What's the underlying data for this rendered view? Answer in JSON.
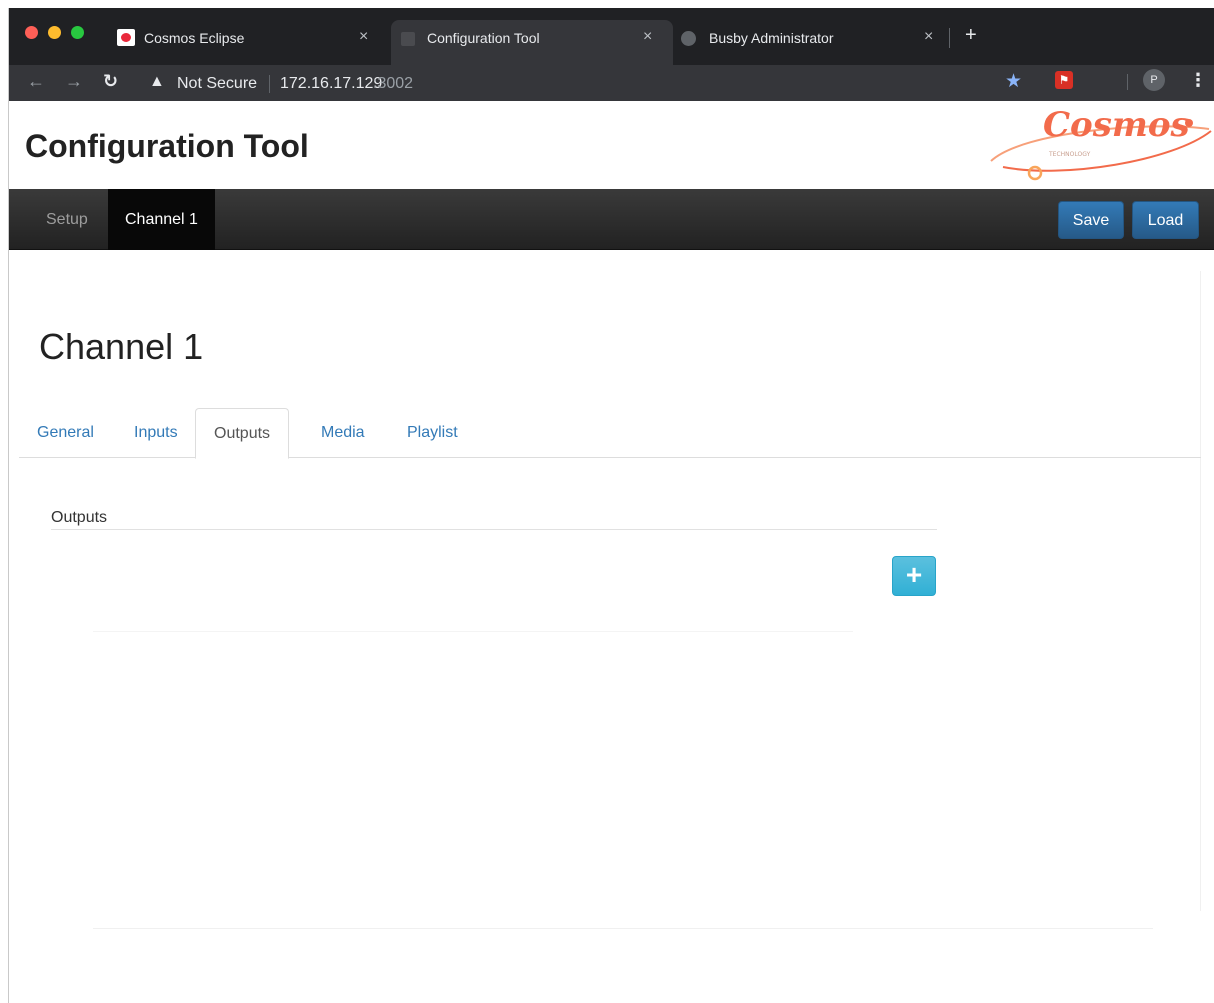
{
  "browser": {
    "tabs": [
      {
        "title": "Cosmos Eclipse",
        "active": false
      },
      {
        "title": "Configuration Tool",
        "active": true
      },
      {
        "title": "Busby Administrator",
        "active": false
      }
    ],
    "close_glyph": "×",
    "new_tab_glyph": "+",
    "security_label": "Not Secure",
    "url_host": "172.16.17.129",
    "url_port": ":3002",
    "profile_initial": "P"
  },
  "header": {
    "title": "Configuration Tool",
    "logo_text": "Cosmos",
    "logo_subtext": "TECHNOLOGY"
  },
  "navbar": {
    "items": [
      {
        "label": "Setup",
        "active": false
      },
      {
        "label": "Channel 1",
        "active": true
      }
    ],
    "save_label": "Save",
    "load_label": "Load"
  },
  "page": {
    "heading": "Channel 1",
    "tabs": [
      {
        "label": "General",
        "active": false
      },
      {
        "label": "Inputs",
        "active": false
      },
      {
        "label": "Outputs",
        "active": true
      },
      {
        "label": "Media",
        "active": false
      },
      {
        "label": "Playlist",
        "active": false
      }
    ],
    "section_label": "Outputs",
    "add_button_glyph": "+"
  },
  "colors": {
    "primary": "#337ab7",
    "info": "#5bc0de",
    "navbar": "#222222",
    "logo": "#f26b4b"
  }
}
